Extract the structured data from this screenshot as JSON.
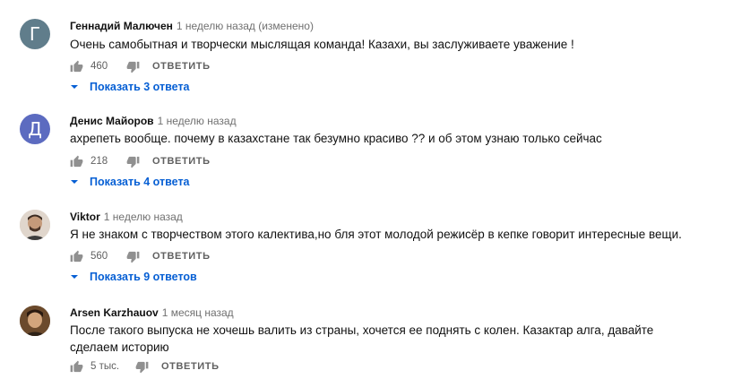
{
  "comments": [
    {
      "avatar_letter": "Г",
      "avatar_color": "#607d8b",
      "author": "Геннадий Малючен",
      "meta": "1 неделю назад (изменено)",
      "lines": [
        "Очень самобытная и творчески мыслящая команда! Казахи, вы заслуживаете уважение !"
      ],
      "likes": "460",
      "reply_label": "ОТВЕТИТЬ",
      "replies_label": "Показать 3 ответа"
    },
    {
      "avatar_letter": "Д",
      "avatar_color": "#5c6bc0",
      "author": "Денис Майоров",
      "meta": "1 неделю назад",
      "lines": [
        "ахрепеть вообще. почему в казахстане так безумно красиво ?? и об этом узнаю только сейчас"
      ],
      "likes": "218",
      "reply_label": "ОТВЕТИТЬ",
      "replies_label": "Показать 4 ответа"
    },
    {
      "avatar_letter": "",
      "avatar_color": "#b8a898",
      "author": "Viktor",
      "meta": "1 неделю назад",
      "lines": [
        "Я не знаком с творчеством этого калектива,но бля этот молодой режисёр в кепке говорит интересные вещи."
      ],
      "likes": "560",
      "reply_label": "ОТВЕТИТЬ",
      "replies_label": "Показать 9 ответов"
    },
    {
      "avatar_letter": "",
      "avatar_color": "#7a5a3a",
      "author": "Arsen Karzhauov",
      "meta": "1 месяц назад",
      "lines": [
        "После такого выпуска не хочешь валить из страны, хочется ее поднять с колен. Казактар алга, давайте",
        "сделаем историю"
      ],
      "likes": "5 тыс.",
      "reply_label": "ОТВЕТИТЬ"
    }
  ]
}
